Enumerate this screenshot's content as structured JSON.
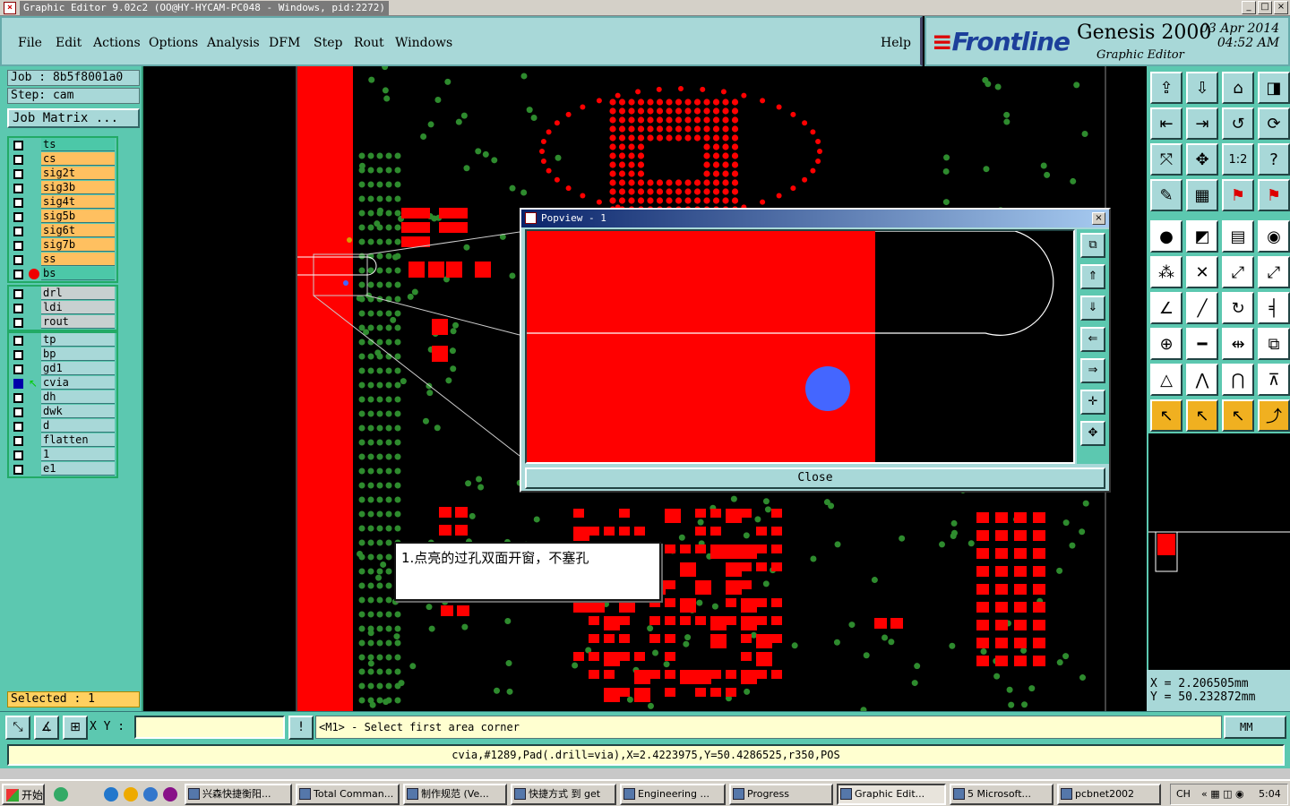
{
  "window": {
    "title": "Graphic Editor 9.02c2 (OO@HY-HYCAM-PC048 - Windows, pid:2272)",
    "min": "_",
    "max": "□",
    "close": "×"
  },
  "menu": {
    "file": "File",
    "edit": "Edit",
    "actions": "Actions",
    "options": "Options",
    "analysis": "Analysis",
    "dfm": "DFM",
    "step": "Step",
    "rout": "Rout",
    "windows": "Windows",
    "help": "Help"
  },
  "brand": {
    "logo": "Frontline",
    "product": "Genesis 2000",
    "subtitle": "Graphic Editor",
    "date": "03 Apr 2014",
    "time": "04:52 AM"
  },
  "job": {
    "job_label": "Job : 8b5f8001a0",
    "step_label": "Step: cam",
    "matrix_button": "Job Matrix ..."
  },
  "layers": {
    "group1": [
      {
        "name": "ts",
        "color": "#4cc8a8"
      },
      {
        "name": "cs",
        "color": "#ffc060"
      },
      {
        "name": "sig2t",
        "color": "#ffc060"
      },
      {
        "name": "sig3b",
        "color": "#ffc060"
      },
      {
        "name": "sig4t",
        "color": "#ffc060"
      },
      {
        "name": "sig5b",
        "color": "#ffc060"
      },
      {
        "name": "sig6t",
        "color": "#ffc060"
      },
      {
        "name": "sig7b",
        "color": "#ffc060"
      },
      {
        "name": "ss",
        "color": "#ffc060"
      },
      {
        "name": "bs",
        "color": "#4cc8a8"
      }
    ],
    "group2": [
      {
        "name": "drl",
        "color": "#c8d0d0"
      },
      {
        "name": "ldi",
        "color": "#c8d0d0"
      },
      {
        "name": "rout",
        "color": "#c8d0d0"
      }
    ],
    "group3": [
      {
        "name": "tp",
        "color": "#a8d8d8"
      },
      {
        "name": "bp",
        "color": "#a8d8d8"
      },
      {
        "name": "gd1",
        "color": "#a8d8d8"
      },
      {
        "name": "cvia",
        "color": "#a8d8d8"
      },
      {
        "name": "dh",
        "color": "#a8d8d8"
      },
      {
        "name": "dwk",
        "color": "#a8d8d8"
      },
      {
        "name": "d",
        "color": "#a8d8d8"
      },
      {
        "name": "flatten",
        "color": "#a8d8d8"
      },
      {
        "name": "1",
        "color": "#a8d8d8"
      },
      {
        "name": "e1",
        "color": "#a8d8d8"
      }
    ]
  },
  "selected": "Selected : 1",
  "coords": {
    "x": "X  =  2.206505mm",
    "y": "Y  =  50.232872mm"
  },
  "cmd": {
    "xy_label": "X Y :",
    "xy_value": "",
    "prompt": "<M1> - Select first area corner",
    "units": "MM"
  },
  "info": "cvia,#1289,Pad(.drill=via),X=2.4223975,Y=50.4286525,r350,POS",
  "popview": {
    "title": "Popview - 1",
    "close_label": "Close"
  },
  "annotation": "1.点亮的过孔双面开窗，不塞孔",
  "taskbar": {
    "start": "开始",
    "tasks": [
      "兴森快捷衡阳...",
      "Total Comman...",
      "制作规范 (Ve...",
      "快捷方式 到 get",
      "Engineering ...",
      "Progress",
      "Graphic Edit...",
      "5 Microsoft...",
      "pcbnet2002"
    ],
    "ime": "CH",
    "clock": "5:04"
  },
  "colors": {
    "copper": "#ff0000",
    "via": "#2e8b2e",
    "highlight": "#4466ff",
    "panel": "#5cc8b0",
    "menubg": "#a8d8d8"
  }
}
